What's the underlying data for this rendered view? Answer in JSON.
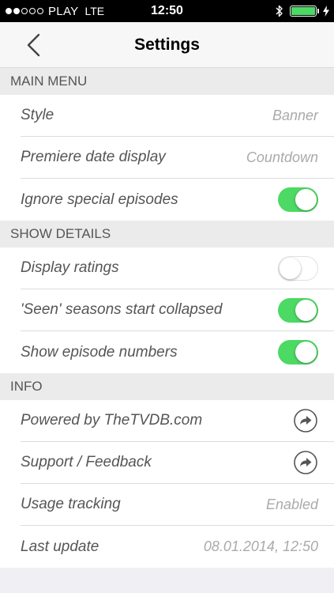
{
  "status_bar": {
    "signal_filled": 2,
    "signal_total": 5,
    "carrier": "PLAY",
    "network": "LTE",
    "time": "12:50",
    "battery_level": 1.0
  },
  "nav": {
    "title": "Settings",
    "back_icon": "chevron-left-icon"
  },
  "sections": {
    "main_menu": {
      "header": "MAIN MENU",
      "style_label": "Style",
      "style_value": "Banner",
      "premiere_label": "Premiere date display",
      "premiere_value": "Countdown",
      "ignore_special_label": "Ignore special episodes",
      "ignore_special_on": true
    },
    "show_details": {
      "header": "SHOW DETAILS",
      "ratings_label": "Display ratings",
      "ratings_on": false,
      "seen_label": "'Seen' seasons start collapsed",
      "seen_on": true,
      "episode_numbers_label": "Show episode numbers",
      "episode_numbers_on": true
    },
    "info": {
      "header": "INFO",
      "powered_label": "Powered by TheTVDB.com",
      "support_label": "Support / Feedback",
      "usage_label": "Usage tracking",
      "usage_value": "Enabled",
      "last_update_label": "Last update",
      "last_update_value": "08.01.2014, 12:50"
    }
  },
  "colors": {
    "toggle_on": "#4cd964",
    "battery": "#4cd964"
  }
}
